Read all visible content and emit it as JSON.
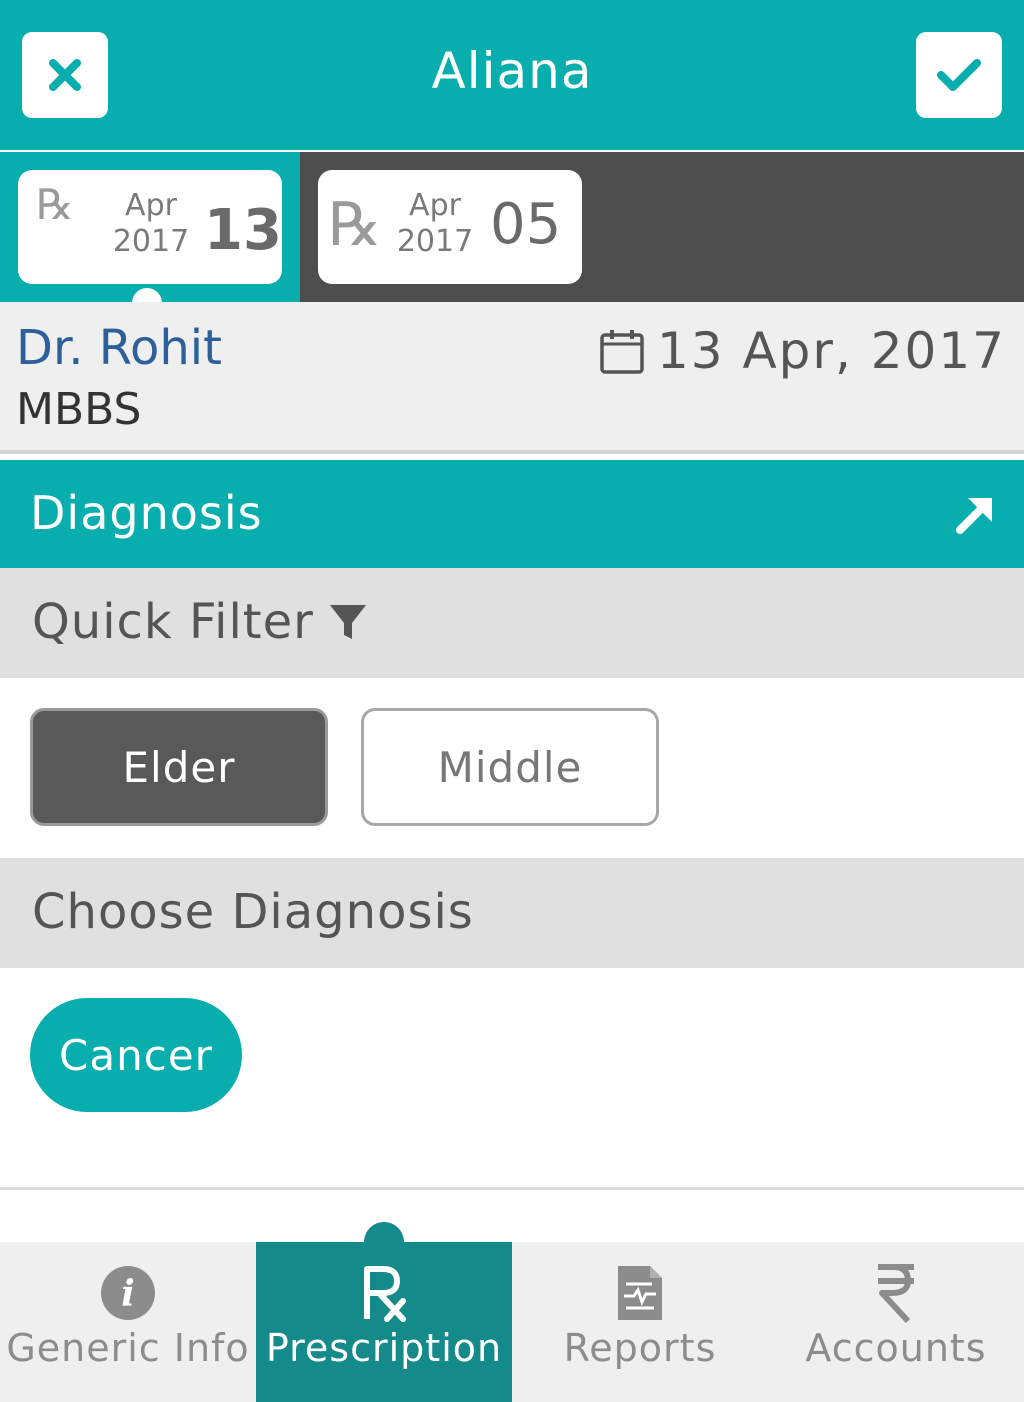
{
  "header": {
    "title": "Aliana",
    "close_icon": "close-icon",
    "check_icon": "check-icon",
    "accent_color": "#08aeae"
  },
  "prescriptions": [
    {
      "symbol": "℞",
      "month": "Apr",
      "year": "2017",
      "day": "13",
      "active": true
    },
    {
      "symbol": "℞",
      "month": "Apr",
      "year": "2017",
      "day": "05",
      "active": false
    }
  ],
  "doctor": {
    "name": "Dr. Rohit",
    "degree": "MBBS",
    "date": "13 Apr, 2017",
    "date_icon": "calendar-icon"
  },
  "diagnosis": {
    "title": "Diagnosis",
    "arrow_icon": "expand-arrow-icon"
  },
  "quick_filter": {
    "label": "Quick Filter",
    "icon": "filter-icon",
    "options": [
      {
        "label": "Elder",
        "selected": true
      },
      {
        "label": "Middle",
        "selected": false
      }
    ]
  },
  "choose_diagnosis": {
    "label": "Choose Diagnosis",
    "items": [
      "Cancer"
    ]
  },
  "bottom_nav": [
    {
      "label": "Generic Info",
      "icon": "info-icon",
      "active": false
    },
    {
      "label": "Prescription",
      "icon": "rx-icon",
      "active": true
    },
    {
      "label": "Reports",
      "icon": "report-icon",
      "active": false
    },
    {
      "label": "Accounts",
      "icon": "rupee-icon",
      "active": false
    }
  ]
}
